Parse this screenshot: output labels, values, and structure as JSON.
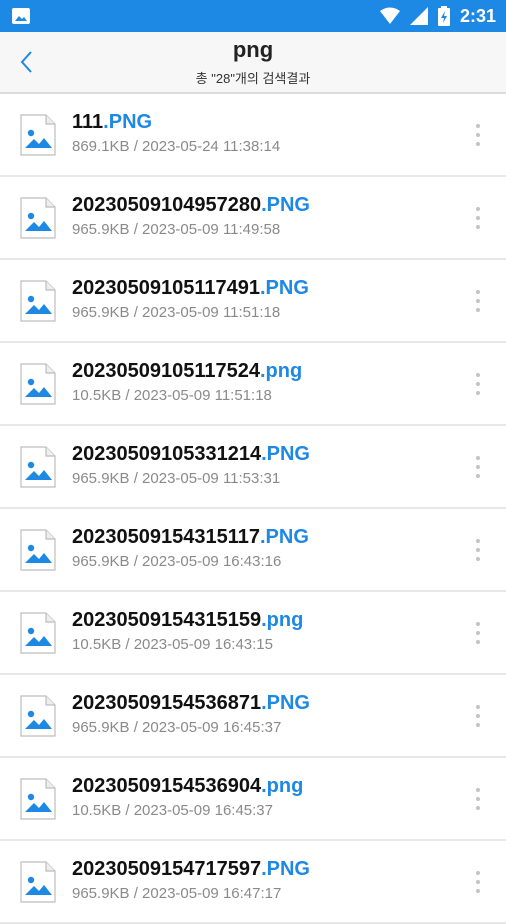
{
  "status_bar": {
    "time": "2:31",
    "icons": [
      "image-notification-icon",
      "wifi-icon",
      "signal-icon",
      "battery-icon"
    ]
  },
  "app_bar": {
    "title": "png",
    "subtitle": "총 \"28\"개의 검색결과",
    "back_icon": "chevron-left-icon"
  },
  "colors": {
    "accent": "#1e88e5",
    "status_bar": "#1e88e5",
    "meta_text": "#8a8a8a"
  },
  "files": [
    {
      "base": "111",
      "ext": ".PNG",
      "meta": "869.1KB / 2023-05-24 11:38:14"
    },
    {
      "base": "20230509104957280",
      "ext": ".PNG",
      "meta": "965.9KB / 2023-05-09 11:49:58"
    },
    {
      "base": "20230509105117491",
      "ext": ".PNG",
      "meta": "965.9KB / 2023-05-09 11:51:18"
    },
    {
      "base": "20230509105117524",
      "ext": ".png",
      "meta": "10.5KB / 2023-05-09 11:51:18"
    },
    {
      "base": "20230509105331214",
      "ext": ".PNG",
      "meta": "965.9KB / 2023-05-09 11:53:31"
    },
    {
      "base": "20230509154315117",
      "ext": ".PNG",
      "meta": "965.9KB / 2023-05-09 16:43:16"
    },
    {
      "base": "20230509154315159",
      "ext": ".png",
      "meta": "10.5KB / 2023-05-09 16:43:15"
    },
    {
      "base": "20230509154536871",
      "ext": ".PNG",
      "meta": "965.9KB / 2023-05-09 16:45:37"
    },
    {
      "base": "20230509154536904",
      "ext": ".png",
      "meta": "10.5KB / 2023-05-09 16:45:37"
    },
    {
      "base": "20230509154717597",
      "ext": ".PNG",
      "meta": "965.9KB / 2023-05-09 16:47:17"
    }
  ]
}
